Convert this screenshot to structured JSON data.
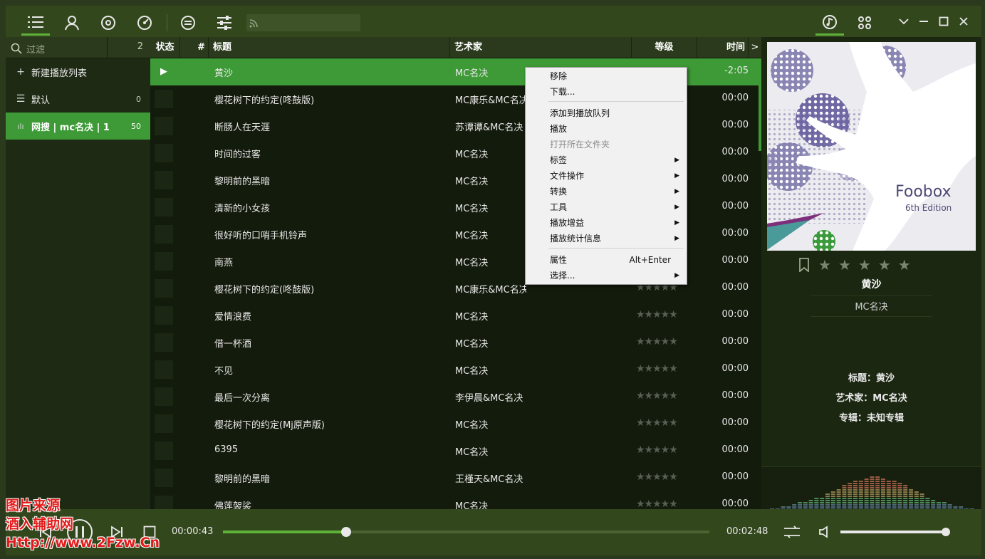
{
  "colors": {
    "accent": "#3d9a36",
    "topbar": "#33471d",
    "list_bg": "#131b0c",
    "menu_bg": "#f1f1f1"
  },
  "topbar": {
    "icons": [
      "list-icon",
      "user-icon",
      "disc-icon",
      "gauge-icon",
      "equalizer-icon",
      "sliders-icon"
    ],
    "feed_icon": "rss-icon",
    "right_icons": [
      "music-note-icon",
      "grid-icon"
    ],
    "window_buttons": [
      "chevron-down-icon",
      "minimize-icon",
      "maximize-icon",
      "close-icon"
    ]
  },
  "sidebar": {
    "filter_placeholder": "过滤",
    "filter_count": "2",
    "items": [
      {
        "icon": "+",
        "label": "新建播放列表",
        "count": ""
      },
      {
        "icon": "☰",
        "label": "默认",
        "count": "0"
      },
      {
        "icon": "ılı",
        "label": "网搜 | mc名决 | 1",
        "count": "50"
      }
    ]
  },
  "list": {
    "columns": {
      "status": "状态",
      "num": "#",
      "title": "标题",
      "artist": "艺术家",
      "rating": "等级",
      "time": "时间",
      "more": ">"
    },
    "rows": [
      {
        "title": "黄沙",
        "artist": "MC名决",
        "time": "-2:05"
      },
      {
        "title": "樱花树下的约定(咚鼓版)",
        "artist": "MC康乐&MC名决",
        "time": "00:00"
      },
      {
        "title": "断肠人在天涯",
        "artist": "苏谭谭&MC名决",
        "time": "00:00"
      },
      {
        "title": "时间的过客",
        "artist": "MC名决",
        "time": "00:00"
      },
      {
        "title": "黎明前的黑暗",
        "artist": "MC名决",
        "time": "00:00"
      },
      {
        "title": "清新的小女孩",
        "artist": "MC名决",
        "time": "00:00"
      },
      {
        "title": "很好听的口哨手机铃声",
        "artist": "MC名决",
        "time": "00:00"
      },
      {
        "title": "南燕",
        "artist": "MC名决",
        "time": "00:00"
      },
      {
        "title": "樱花树下的约定(咚鼓版)",
        "artist": "MC康乐&MC名决",
        "time": "00:00"
      },
      {
        "title": "爱情浪费",
        "artist": "MC名决",
        "time": "00:00"
      },
      {
        "title": "借一杯酒",
        "artist": "MC名决",
        "time": "00:00"
      },
      {
        "title": "不见",
        "artist": "MC名决",
        "time": "00:00"
      },
      {
        "title": "最后一次分离",
        "artist": "李伊晨&MC名决",
        "time": "00:00"
      },
      {
        "title": "樱花树下的约定(Mj原声版)",
        "artist": "MC名决",
        "time": "00:00"
      },
      {
        "title": "6395",
        "artist": "MC名决",
        "time": "00:00"
      },
      {
        "title": "黎明前的黑暗",
        "artist": "王槿天&MC名决",
        "time": "00:00"
      },
      {
        "title": "佛莲袈裟",
        "artist": "MC名决",
        "time": "00:00"
      }
    ],
    "rating_stars": "★★★★★",
    "playing_symbol": "▶"
  },
  "context_menu": {
    "items": [
      {
        "label": "移除",
        "arrow": false,
        "disabled": false,
        "shortcut": ""
      },
      {
        "label": "下载...",
        "arrow": false,
        "disabled": false,
        "shortcut": ""
      },
      {
        "label": "添加到播放队列",
        "arrow": false,
        "disabled": false,
        "shortcut": ""
      },
      {
        "label": "播放",
        "arrow": false,
        "disabled": false,
        "shortcut": ""
      },
      {
        "label": "打开所在文件夹",
        "arrow": false,
        "disabled": true,
        "shortcut": ""
      },
      {
        "label": "标签",
        "arrow": true,
        "disabled": false,
        "shortcut": ""
      },
      {
        "label": "文件操作",
        "arrow": true,
        "disabled": false,
        "shortcut": ""
      },
      {
        "label": "转换",
        "arrow": true,
        "disabled": false,
        "shortcut": ""
      },
      {
        "label": "工具",
        "arrow": true,
        "disabled": false,
        "shortcut": ""
      },
      {
        "label": "播放增益",
        "arrow": true,
        "disabled": false,
        "shortcut": ""
      },
      {
        "label": "播放统计信息",
        "arrow": true,
        "disabled": false,
        "shortcut": ""
      },
      {
        "label": "属性",
        "arrow": false,
        "disabled": false,
        "shortcut": "Alt+Enter"
      },
      {
        "label": "选择...",
        "arrow": true,
        "disabled": false,
        "shortcut": ""
      }
    ]
  },
  "now_playing": {
    "cover_title": "Foobox",
    "cover_subtitle": "6th Edition",
    "title": "黄沙",
    "artist": "MC名决",
    "info_title": "标题：黄沙",
    "info_artist": "艺术家：MC名决",
    "info_album": "专辑：未知专辑",
    "rating": 0,
    "stars": "★"
  },
  "player": {
    "elapsed": "00:00:43",
    "total": "00:02:48",
    "progress": 0.253,
    "volume": 1.0
  },
  "watermark": {
    "line1": "图片来源",
    "line2": "酒入辅助网",
    "line3": "Http://www.2Fzw.Cn"
  }
}
